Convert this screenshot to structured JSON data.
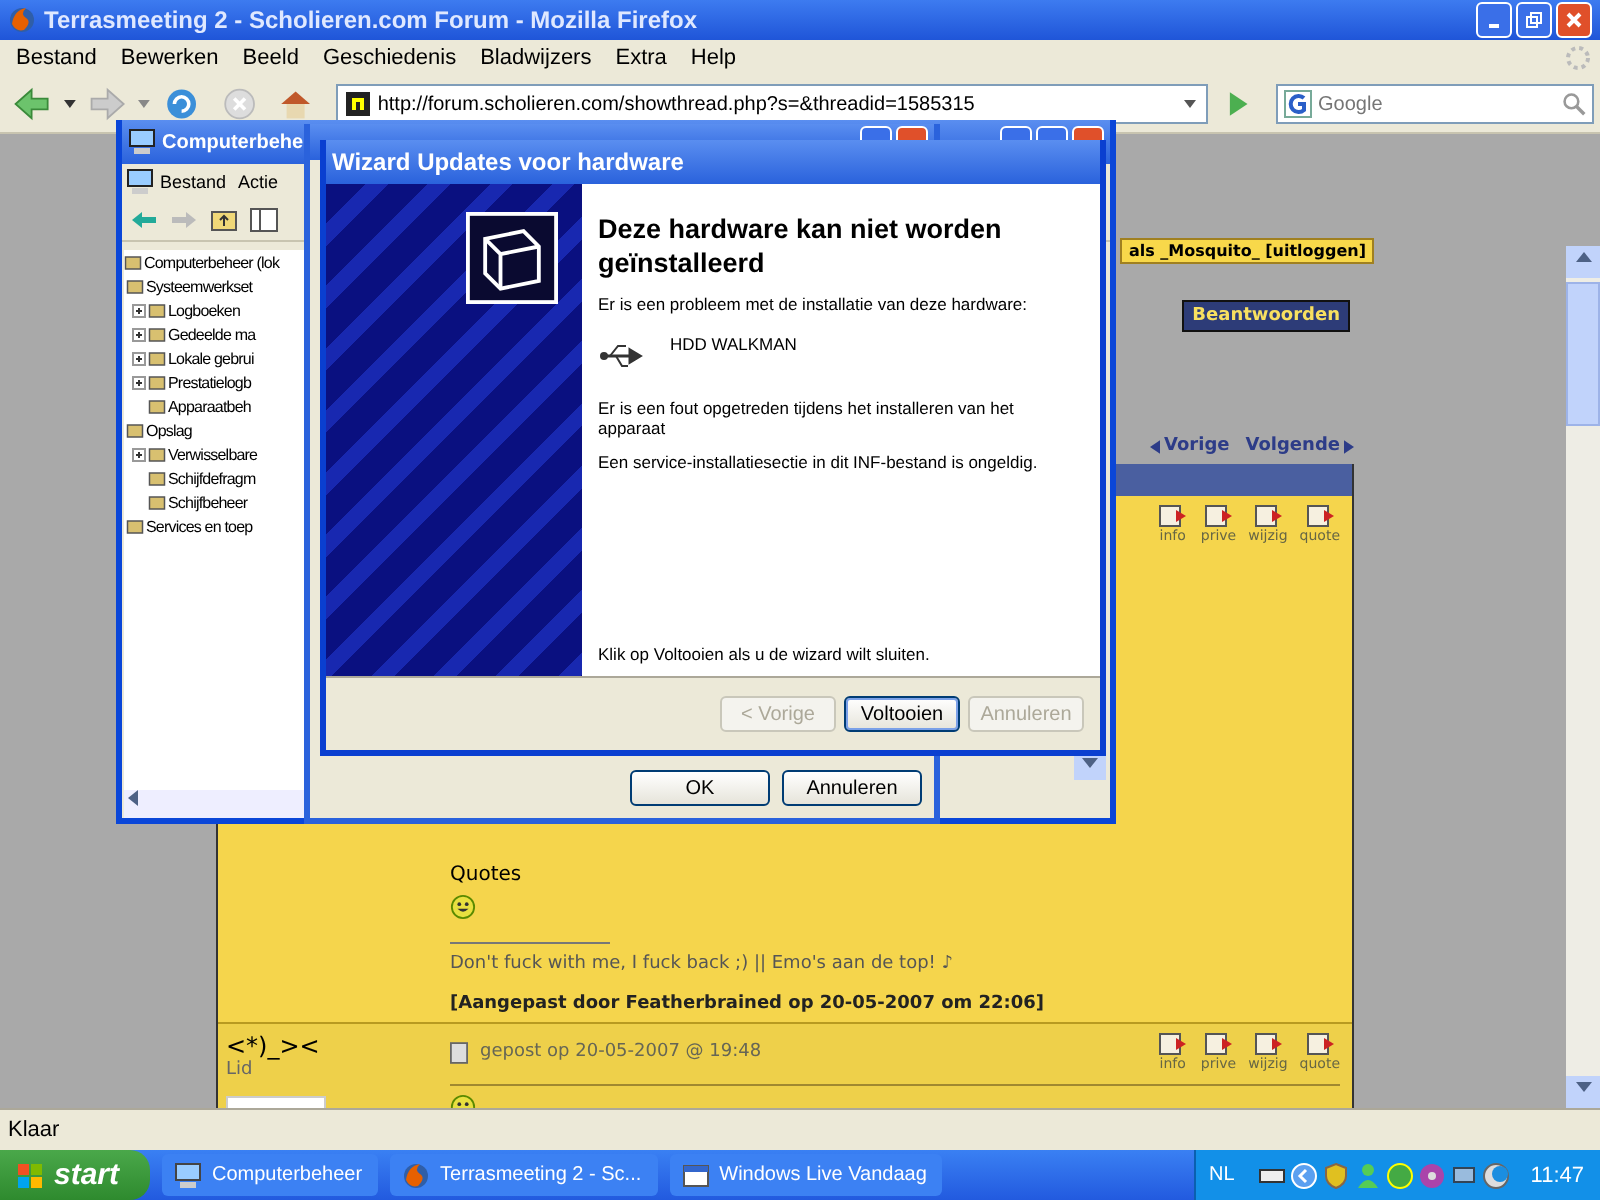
{
  "browser": {
    "title": "Terrasmeeting 2 - Scholieren.com Forum - Mozilla Firefox",
    "menu": [
      "Bestand",
      "Bewerken",
      "Beeld",
      "Geschiedenis",
      "Bladwijzers",
      "Extra",
      "Help"
    ],
    "address": "http://forum.scholieren.com/showthread.php?s=&threadid=1585315",
    "search_placeholder": "Google",
    "status": "Klaar"
  },
  "forum": {
    "user_bar": "als _Mosquito_ [uitloggen]",
    "reply_button": "Beantwoorden",
    "prev": "Vorige",
    "next": "Volgende",
    "posts": [
      {
        "actions": [
          "info",
          "prive",
          "wijzig",
          "quote"
        ],
        "body": "Quotes",
        "signature": "Don't fuck with me, I fuck back ;) || Emo's aan de top! ♪",
        "edited": "[Aangepast door Featherbrained op 20-05-2007 om 22:06]"
      },
      {
        "author": "<*)_><",
        "rank": "Lid",
        "posted": "gepost op 20-05-2007 @ 19:48",
        "actions": [
          "info",
          "prive",
          "wijzig",
          "quote"
        ]
      }
    ]
  },
  "computer_management": {
    "title": "Computerbehe",
    "menu": [
      "Bestand",
      "Actie"
    ],
    "tree": [
      {
        "label": "Computerbeheer (lok",
        "children": [
          {
            "label": "Systeemwerkset",
            "children": [
              {
                "label": "Logboeken",
                "collapsed": true
              },
              {
                "label": "Gedeelde ma",
                "collapsed": true
              },
              {
                "label": "Lokale gebrui",
                "collapsed": true
              },
              {
                "label": "Prestatielogb",
                "collapsed": true
              },
              {
                "label": "Apparaatbeh",
                "collapsed": false
              }
            ]
          },
          {
            "label": "Opslag",
            "children": [
              {
                "label": "Verwisselbare",
                "collapsed": true
              },
              {
                "label": "Schijfdefragm",
                "collapsed": false
              },
              {
                "label": "Schijfbeheer",
                "collapsed": false
              }
            ]
          },
          {
            "label": "Services en toep"
          }
        ]
      }
    ]
  },
  "properties_dialog": {
    "buttons": [
      {
        "label": "OK"
      },
      {
        "label": "Annuleren"
      }
    ]
  },
  "wizard": {
    "title": "Wizard Updates voor hardware",
    "heading": "Deze hardware kan niet worden geïnstalleerd",
    "intro": "Er is een probleem met de installatie van deze hardware:",
    "device": "HDD WALKMAN",
    "error": "Er is een fout opgetreden tijdens het installeren van het apparaat",
    "detail": "Een service-installatiesectie in dit INF-bestand is ongeldig.",
    "finish_hint": "Klik op Voltooien als u de wizard wilt sluiten.",
    "buttons": [
      {
        "label": "< Vorige",
        "disabled": true,
        "default": false
      },
      {
        "label": "Voltooien",
        "disabled": false,
        "default": true
      },
      {
        "label": "Annuleren",
        "disabled": true,
        "default": false
      }
    ]
  },
  "taskbar": {
    "start": "start",
    "items": [
      {
        "label": "Computerbeheer",
        "kind": "computer"
      },
      {
        "label": "Terrasmeeting 2 - Sc...",
        "kind": "browser"
      },
      {
        "label": "Windows Live Vandaag",
        "kind": "window"
      }
    ],
    "language": "NL",
    "clock": "11:47"
  }
}
